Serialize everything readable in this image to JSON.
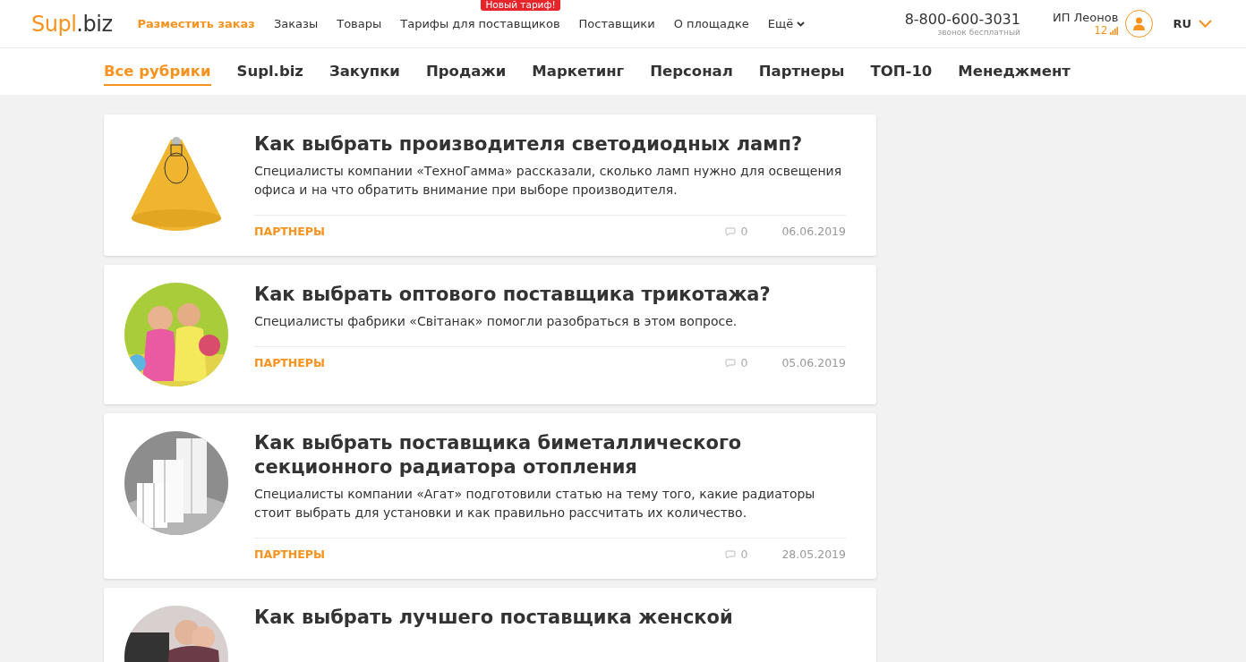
{
  "header": {
    "logo": {
      "accent": "Supl",
      "rest": ".biz"
    },
    "nav": [
      {
        "label": "Разместить заказ",
        "selected": true
      },
      {
        "label": "Заказы",
        "selected": false
      },
      {
        "label": "Товары",
        "selected": false
      },
      {
        "label": "Тарифы для поставщиков",
        "selected": false,
        "badge": "Новый тариф!"
      },
      {
        "label": "Поставщики",
        "selected": false
      },
      {
        "label": "О площадке",
        "selected": false
      },
      {
        "label": "Ещё",
        "selected": false,
        "dropdown": true
      }
    ],
    "phone": "8-800-600-3031",
    "phone_note": "звонок бесплатный",
    "user": {
      "name": "ИП Леонов",
      "rating": "12"
    },
    "language": "RU"
  },
  "categories": [
    {
      "label": "Все рубрики",
      "selected": true
    },
    {
      "label": "Supl.biz",
      "selected": false
    },
    {
      "label": "Закупки",
      "selected": false
    },
    {
      "label": "Продажи",
      "selected": false
    },
    {
      "label": "Маркетинг",
      "selected": false
    },
    {
      "label": "Персонал",
      "selected": false
    },
    {
      "label": "Партнеры",
      "selected": false
    },
    {
      "label": "ТОП-10",
      "selected": false
    },
    {
      "label": "Менеджмент",
      "selected": false
    }
  ],
  "articles": [
    {
      "title": "Как выбрать производителя светодиодных ламп?",
      "summary": "Специалисты компании «ТехноГамма» рассказали, сколько ламп нужно для освещения офиса и на что обратить внимание при выборе производителя.",
      "tag": "ПАРТНЕРЫ",
      "comments": "0",
      "date": "06.06.2019"
    },
    {
      "title": "Как выбрать оптового поставщика трикотажа?",
      "summary": "Специалисты фабрики «Світанак» помогли разобраться в этом вопросе.",
      "tag": "ПАРТНЕРЫ",
      "comments": "0",
      "date": "05.06.2019"
    },
    {
      "title": "Как выбрать поставщика биметаллического секционного радиатора отопления",
      "summary": "Специалисты компании «Агат» подготовили статью на тему того, какие радиаторы стоит выбрать для установки и как правильно рассчитать их количество.",
      "tag": "ПАРТНЕРЫ",
      "comments": "0",
      "date": "28.05.2019"
    },
    {
      "title": "Как выбрать лучшего поставщика женской"
    }
  ]
}
